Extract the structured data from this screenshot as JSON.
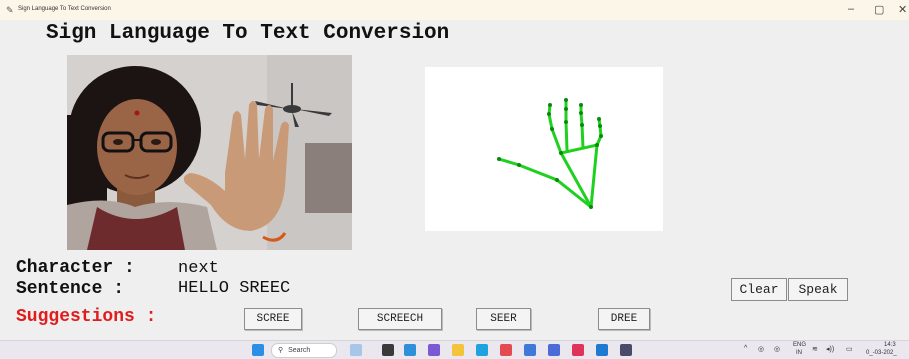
{
  "window": {
    "title": "Sign Language To Text Conversion",
    "minimize": "–",
    "maximize": "▢",
    "close": "✕"
  },
  "app_title": "Sign Language To Text Conversion",
  "character": {
    "label": "Character :",
    "value": "next"
  },
  "sentence": {
    "label": "Sentence :",
    "value": "HELLO SREEC"
  },
  "suggestions": {
    "label": "Suggestions :",
    "items": [
      "SCREE",
      "SCREECH",
      "SEER",
      "DREE"
    ]
  },
  "actions": {
    "clear": "Clear",
    "speak": "Speak"
  },
  "taskbar": {
    "search_placeholder": "Search",
    "lang": "ENG",
    "region": "IN",
    "time": "14:3",
    "date": "0_-03-202_"
  },
  "colors": {
    "suggestion_label": "#e01d1d",
    "skeleton": "#1fd11f",
    "skeleton_joint": "#0a8a0a"
  }
}
